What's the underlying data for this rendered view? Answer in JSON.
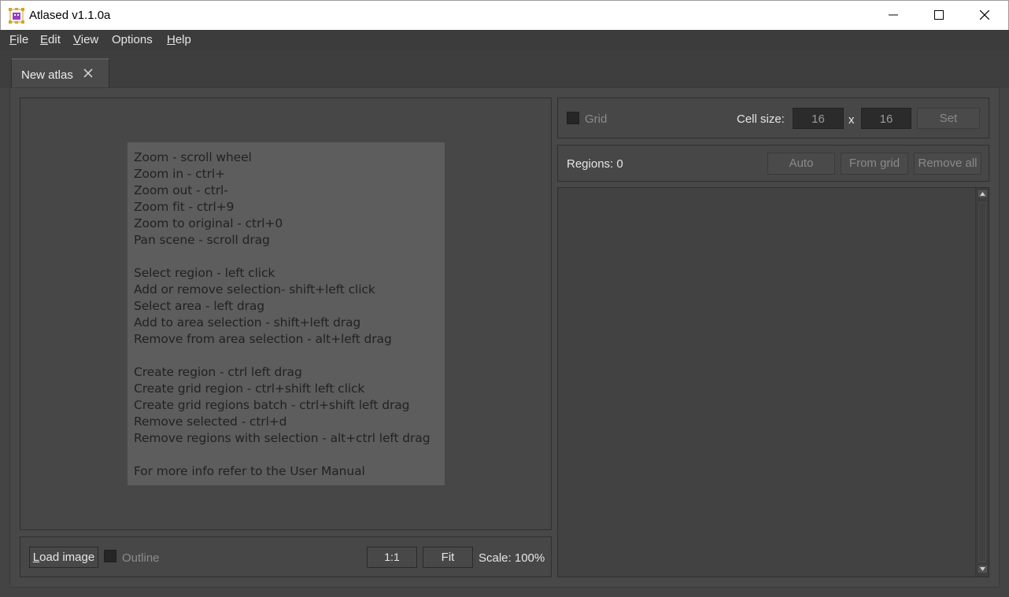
{
  "window": {
    "title": "Atlased v1.1.0a"
  },
  "menu": [
    {
      "mnemonic": "F",
      "rest": "ile"
    },
    {
      "mnemonic": "E",
      "rest": "dit"
    },
    {
      "mnemonic": "V",
      "rest": "iew"
    },
    {
      "mnemonic": "",
      "rest": "Options"
    },
    {
      "mnemonic": "H",
      "rest": "elp"
    }
  ],
  "tabs": [
    {
      "label": "New atlas"
    }
  ],
  "help_lines": [
    "Zoom - scroll wheel",
    "Zoom in - ctrl+",
    "Zoom out - ctrl-",
    "Zoom fit - ctrl+9",
    "Zoom to original - ctrl+0",
    "Pan scene - scroll drag",
    "Select region - left click",
    "Add or remove selection- shift+left click",
    "Select area - left drag",
    "Add to area selection - shift+left drag",
    "Remove from area selection - alt+left drag",
    "Create region - ctrl left drag",
    "Create grid region - ctrl+shift left click",
    "Create grid regions batch - ctrl+shift left drag",
    "Remove selected - ctrl+d",
    "Remove regions with selection - alt+ctrl left drag",
    "For more info refer to the User Manual"
  ],
  "bottom": {
    "load_image_mnemonic": "L",
    "load_image_rest": "oad image",
    "outline_label": "Outline",
    "one_to_one_label": "1:1",
    "fit_label": "Fit",
    "scale_text": "Scale: 100%"
  },
  "grid": {
    "grid_label": "Grid",
    "cell_size_label": "Cell size:",
    "cell_width": "16",
    "separator": "x",
    "cell_height": "16",
    "set_label": "Set"
  },
  "regions": {
    "count_text": "Regions: 0",
    "auto_label": "Auto",
    "from_grid_label": "From grid",
    "remove_all_label": "Remove all"
  }
}
